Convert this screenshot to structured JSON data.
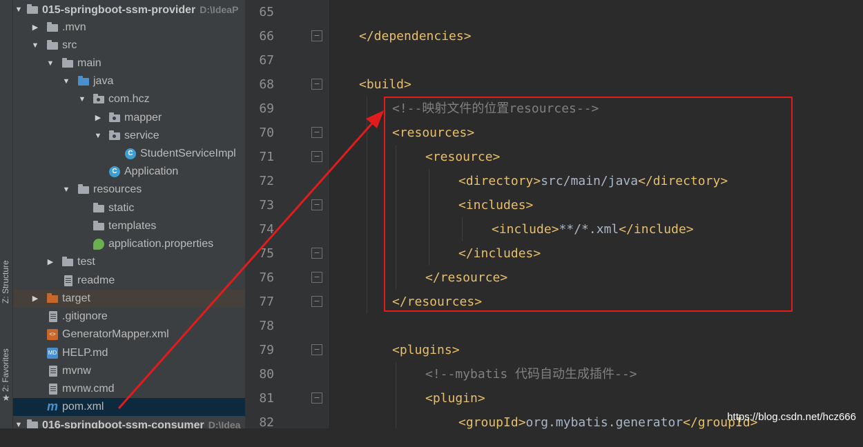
{
  "sidebar_tabs": {
    "structure": "Z: Structure",
    "favorites": "2: Favorites"
  },
  "project_tree": {
    "root": {
      "name": "015-springboot-ssm-provider",
      "path": "D:\\IdeaP"
    },
    "items": [
      {
        "label": "015-springboot-ssm-provider",
        "icon": "module-folder-icon"
      },
      {
        "label": ".mvn",
        "icon": "folder-icon"
      },
      {
        "label": "src",
        "icon": "folder-icon"
      },
      {
        "label": "main",
        "icon": "folder-icon"
      },
      {
        "label": "java",
        "icon": "source-folder-icon"
      },
      {
        "label": "com.hcz",
        "icon": "package-icon"
      },
      {
        "label": "mapper",
        "icon": "package-icon"
      },
      {
        "label": "service",
        "icon": "package-icon"
      },
      {
        "label": "StudentServiceImpl",
        "icon": "class-icon"
      },
      {
        "label": "Application",
        "icon": "spring-boot-class-icon"
      },
      {
        "label": "resources",
        "icon": "resources-folder-icon"
      },
      {
        "label": "static",
        "icon": "folder-icon"
      },
      {
        "label": "templates",
        "icon": "folder-icon"
      },
      {
        "label": "application.properties",
        "icon": "spring-properties-icon"
      },
      {
        "label": "test",
        "icon": "folder-icon"
      },
      {
        "label": "readme",
        "icon": "file-icon"
      },
      {
        "label": "target",
        "icon": "excluded-folder-icon"
      },
      {
        "label": ".gitignore",
        "icon": "file-icon"
      },
      {
        "label": "GeneratorMapper.xml",
        "icon": "xml-file-icon"
      },
      {
        "label": "HELP.md",
        "icon": "markdown-file-icon"
      },
      {
        "label": "mvnw",
        "icon": "file-icon"
      },
      {
        "label": "mvnw.cmd",
        "icon": "file-icon"
      },
      {
        "label": "pom.xml",
        "icon": "maven-icon"
      },
      {
        "label": "016-springboot-ssm-consumer",
        "icon": "module-folder-icon"
      }
    ],
    "second_root_path": "D:\\Idea"
  },
  "editor": {
    "line_numbers": [
      "65",
      "66",
      "67",
      "68",
      "69",
      "70",
      "71",
      "72",
      "73",
      "74",
      "75",
      "76",
      "77",
      "78",
      "79",
      "80",
      "81",
      "82"
    ],
    "lines": {
      "l66": "</dependencies>",
      "l68": "<build>",
      "l69": "<!--映射文件的位置resources-->",
      "l70": "<resources>",
      "l71": "<resource>",
      "l72_open": "<directory>",
      "l72_text": "src/main/java",
      "l72_close": "</directory>",
      "l73": "<includes>",
      "l74_open": "<include>",
      "l74_text": "**/*.xml",
      "l74_close": "</include>",
      "l75": "</includes>",
      "l76": "</resource>",
      "l77": "</resources>",
      "l79": "<plugins>",
      "l80": "<!--mybatis 代码自动生成插件-->",
      "l81": "<plugin>",
      "l82_open": "<groupId>",
      "l82_text": "org.mybatis.generator",
      "l82_close": "</groupId>"
    }
  },
  "watermark": "https://blog.csdn.net/hcz666",
  "colors": {
    "annotation": "#e21c1c",
    "tag": "#e8bf6a",
    "comment": "#808080",
    "background": "#2b2b2b"
  }
}
